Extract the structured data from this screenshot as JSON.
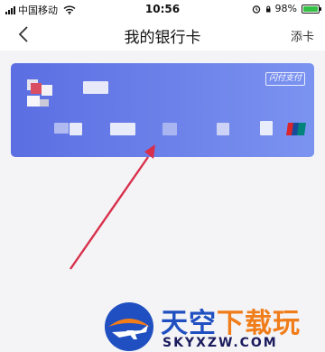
{
  "status_bar": {
    "carrier": "中国移动",
    "time": "10:56",
    "battery_percent": "98%",
    "battery_level": 0.98
  },
  "nav": {
    "title": "我的银行卡",
    "back_icon": "chevron-left-icon",
    "add_card_label": "添卡"
  },
  "card": {
    "quickpass_label": "闪付支付",
    "network_logo": "unionpay-logo",
    "colors": {
      "gradient_start": "#5b6ee2",
      "gradient_end": "#7b93f0"
    }
  },
  "annotation": {
    "arrow_color": "#d8304c"
  },
  "watermark": {
    "title_blue": "天空",
    "title_orange": "下载玩",
    "domain": "SKYXZW.COM"
  }
}
